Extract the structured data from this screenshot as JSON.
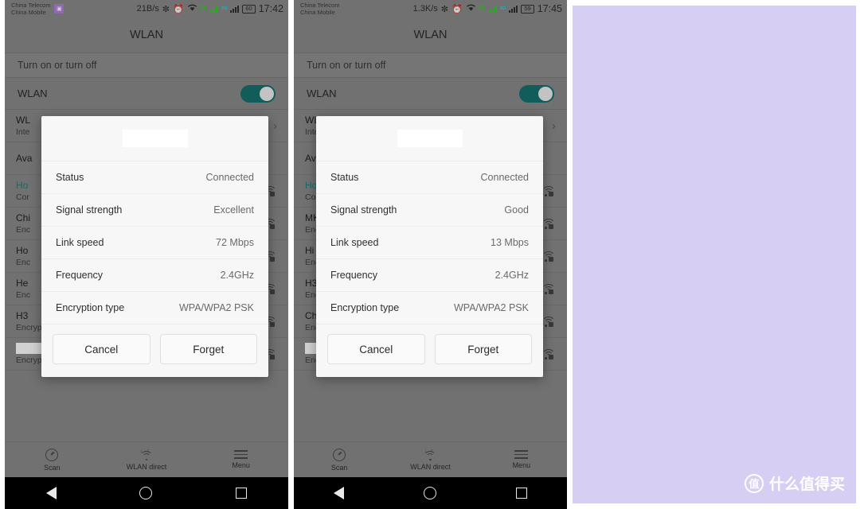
{
  "page": {
    "background": "#ffffff",
    "right_panel_color": "#d7cef4"
  },
  "watermark": {
    "badge": "值",
    "text": "什么值得买"
  },
  "phones": [
    {
      "id": "left",
      "status_bar": {
        "carrier_line1": "China Telecom",
        "carrier_line2": "China Mobile",
        "sim_badge": "sim-card-icon",
        "data_rate": "21B/s",
        "bluetooth_icon": "✻",
        "alarm_icon": "⏰",
        "wifi_icon": "wifi-icon",
        "net_label_top": "4G",
        "net_label_bottom": "2G",
        "net_label_second": "2G",
        "battery": "60",
        "clock": "17:42"
      },
      "title": "WLAN",
      "section_label": "Turn on or turn off",
      "toggle": {
        "label": "WLAN",
        "on": true,
        "color": "#17716f"
      },
      "rows": [
        {
          "t1": "WL",
          "t2": "Inte",
          "trailing": "chevron",
          "redacted": false,
          "teal": false
        },
        {
          "t1": "Ava",
          "t2": "",
          "trailing": "none",
          "redacted": false,
          "teal": false
        },
        {
          "t1": "Ho",
          "t2": "Cor",
          "trailing": "wifi-lock",
          "redacted": false,
          "teal": true
        },
        {
          "t1": "Chi",
          "t2": "Enc",
          "trailing": "wifi-lock",
          "redacted": false,
          "teal": false
        },
        {
          "t1": "Ho",
          "t2": "Enc",
          "trailing": "wifi-lock",
          "redacted": false,
          "teal": false
        },
        {
          "t1": "He",
          "t2": "Enc",
          "trailing": "wifi-lock",
          "redacted": false,
          "teal": false
        },
        {
          "t1": "H3",
          "t2": "Encrypted",
          "trailing": "wifi-lock",
          "redacted": false,
          "teal": false
        },
        {
          "t1": "",
          "t2": "Encrypted",
          "trailing": "wifi-lock",
          "redacted": true,
          "teal": false
        }
      ],
      "toolbar": [
        {
          "icon": "scan-icon",
          "label": "Scan"
        },
        {
          "icon": "wlan-direct-icon",
          "label": "WLAN direct"
        },
        {
          "icon": "menu-icon",
          "label": "Menu"
        }
      ],
      "nav": {
        "back": "back-icon",
        "home": "home-icon",
        "recent": "recents-icon"
      },
      "dialog": {
        "title_redacted": true,
        "rows": [
          {
            "key": "Status",
            "value": "Connected"
          },
          {
            "key": "Signal strength",
            "value": "Excellent"
          },
          {
            "key": "Link speed",
            "value": "72 Mbps"
          },
          {
            "key": "Frequency",
            "value": "2.4GHz"
          },
          {
            "key": "Encryption type",
            "value": "WPA/WPA2 PSK"
          }
        ],
        "cancel_label": "Cancel",
        "forget_label": "Forget"
      }
    },
    {
      "id": "right",
      "status_bar": {
        "carrier_line1": "China Telecom",
        "carrier_line2": "China Mobile",
        "sim_badge": "",
        "data_rate": "1.3K/s",
        "bluetooth_icon": "✻",
        "alarm_icon": "⏰",
        "wifi_icon": "wifi-icon",
        "net_label_top": "4G",
        "net_label_bottom": "2G",
        "net_label_second": "2G",
        "battery": "59",
        "clock": "17:45"
      },
      "title": "WLAN",
      "section_label": "Turn on or turn off",
      "toggle": {
        "label": "WLAN",
        "on": true,
        "color": "#17716f"
      },
      "rows": [
        {
          "t1": "WL",
          "t2": "Inte",
          "trailing": "chevron",
          "redacted": false,
          "teal": false
        },
        {
          "t1": "Ava",
          "t2": "",
          "trailing": "none",
          "redacted": false,
          "teal": false
        },
        {
          "t1": "Ho",
          "t2": "Cor",
          "trailing": "wifi-lock",
          "redacted": false,
          "teal": true
        },
        {
          "t1": "MK",
          "t2": "Enc",
          "trailing": "wifi-lock",
          "redacted": false,
          "teal": false
        },
        {
          "t1": "Hi",
          "t2": "Enc",
          "trailing": "wifi-lock",
          "redacted": false,
          "teal": false
        },
        {
          "t1": "H3",
          "t2": "Enc",
          "trailing": "wifi-lock",
          "redacted": false,
          "teal": false
        },
        {
          "t1": "Chi",
          "t2": "Encrypted (WPS available)",
          "trailing": "wifi-lock",
          "redacted": false,
          "teal": false
        },
        {
          "t1": "",
          "t2": "Encrypted (WPS available)",
          "trailing": "wifi-lock",
          "redacted": true,
          "teal": false
        }
      ],
      "toolbar": [
        {
          "icon": "scan-icon",
          "label": "Scan"
        },
        {
          "icon": "wlan-direct-icon",
          "label": "WLAN direct"
        },
        {
          "icon": "menu-icon",
          "label": "Menu"
        }
      ],
      "nav": {
        "back": "back-icon",
        "home": "home-icon",
        "recent": "recents-icon"
      },
      "dialog": {
        "title_redacted": true,
        "rows": [
          {
            "key": "Status",
            "value": "Connected"
          },
          {
            "key": "Signal strength",
            "value": "Good"
          },
          {
            "key": "Link speed",
            "value": "13 Mbps"
          },
          {
            "key": "Frequency",
            "value": "2.4GHz"
          },
          {
            "key": "Encryption type",
            "value": "WPA/WPA2 PSK"
          }
        ],
        "cancel_label": "Cancel",
        "forget_label": "Forget"
      }
    }
  ]
}
